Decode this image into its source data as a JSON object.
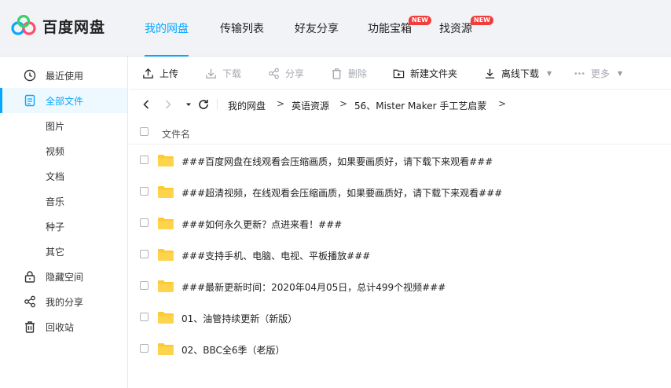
{
  "brand": {
    "name": "百度网盘",
    "colors": {
      "accent": "#06a7ff",
      "badge": "#f23d3d",
      "folder": "#ffc933"
    }
  },
  "nav": {
    "items": [
      {
        "label": "我的网盘",
        "active": true
      },
      {
        "label": "传输列表"
      },
      {
        "label": "好友分享"
      },
      {
        "label": "功能宝箱",
        "badge": "NEW"
      },
      {
        "label": "找资源",
        "badge": "NEW"
      }
    ]
  },
  "sidebar": {
    "items": [
      {
        "label": "最近使用",
        "icon": "clock-icon"
      },
      {
        "label": "全部文件",
        "icon": "file-icon",
        "active": true
      },
      {
        "label": "图片"
      },
      {
        "label": "视频"
      },
      {
        "label": "文档"
      },
      {
        "label": "音乐"
      },
      {
        "label": "种子"
      },
      {
        "label": "其它"
      },
      {
        "label": "隐藏空间",
        "icon": "lock-icon"
      },
      {
        "label": "我的分享",
        "icon": "share-icon"
      },
      {
        "label": "回收站",
        "icon": "trash-icon"
      }
    ]
  },
  "toolbar": {
    "upload": "上传",
    "download": "下载",
    "share": "分享",
    "delete": "删除",
    "new_folder": "新建文件夹",
    "offline_download": "离线下载",
    "more": "更多"
  },
  "path": {
    "crumbs": [
      "我的网盘",
      "英语资源",
      "56、Mister Maker 手工艺启蒙"
    ],
    "separator": ">"
  },
  "list": {
    "column_name": "文件名",
    "files": [
      "###百度网盘在线观看会压缩画质，如果要画质好，请下载下来观看###",
      "###超清视频，在线观看会压缩画质，如果要画质好，请下载下来观看###",
      "###如何永久更新？点进来看！###",
      "###支持手机、电脑、电视、平板播放###",
      "###最新更新时间：2020年04月05日，总计499个视频###",
      "01、油管持续更新（新版）",
      "02、BBC全6季（老版）"
    ]
  }
}
